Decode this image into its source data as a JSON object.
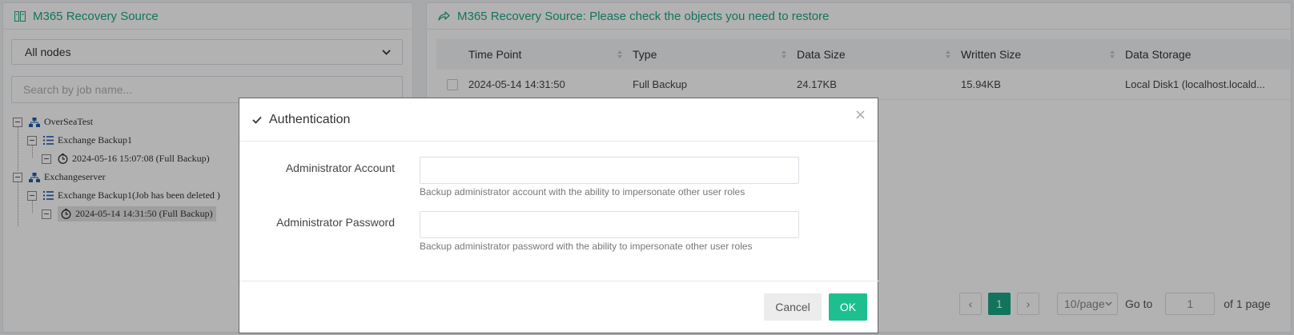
{
  "left_panel": {
    "title": "M365 Recovery Source",
    "node_select": "All nodes",
    "search_placeholder": "Search by job name...",
    "tree": [
      {
        "label": "OverSeaTest",
        "icon": "sitemap-icon",
        "level": 0
      },
      {
        "label": "Exchange Backup1",
        "icon": "list-icon",
        "level": 1
      },
      {
        "label": "2024-05-16 15:07:08 (Full  Backup)",
        "icon": "clock-icon",
        "level": 2
      },
      {
        "label": "Exchangeserver",
        "icon": "sitemap-icon",
        "level": 0
      },
      {
        "label": "Exchange Backup1(Job has been deleted )",
        "icon": "list-icon",
        "level": 1
      },
      {
        "label": "2024-05-14 14:31:50 (Full  Backup)",
        "icon": "clock-icon",
        "level": 2,
        "selected": true
      }
    ]
  },
  "right_panel": {
    "title": "M365 Recovery Source: Please check the objects you need to restore",
    "columns": [
      "Time Point",
      "Type",
      "Data Size",
      "Written Size",
      "Data Storage"
    ],
    "rows": [
      [
        "2024-05-14 14:31:50",
        "Full Backup",
        "24.17KB",
        "15.94KB",
        "Local Disk1 (localhost.locald..."
      ]
    ],
    "pagination": {
      "prev": "‹",
      "current": "1",
      "next": "›",
      "page_size": "10/page",
      "goto_label": "Go to",
      "goto_value": "1",
      "total": "of 1 page"
    }
  },
  "modal": {
    "title": "Authentication",
    "account_label": "Administrator Account",
    "account_help": "Backup administrator account with the ability to impersonate other user roles",
    "password_label": "Administrator Password",
    "password_help": "Backup administrator password with the ability to impersonate other user roles",
    "close": "×",
    "cancel": "Cancel",
    "ok": "OK"
  },
  "colors": {
    "accent": "#1ba784",
    "ok_button": "#1ebf8e"
  }
}
